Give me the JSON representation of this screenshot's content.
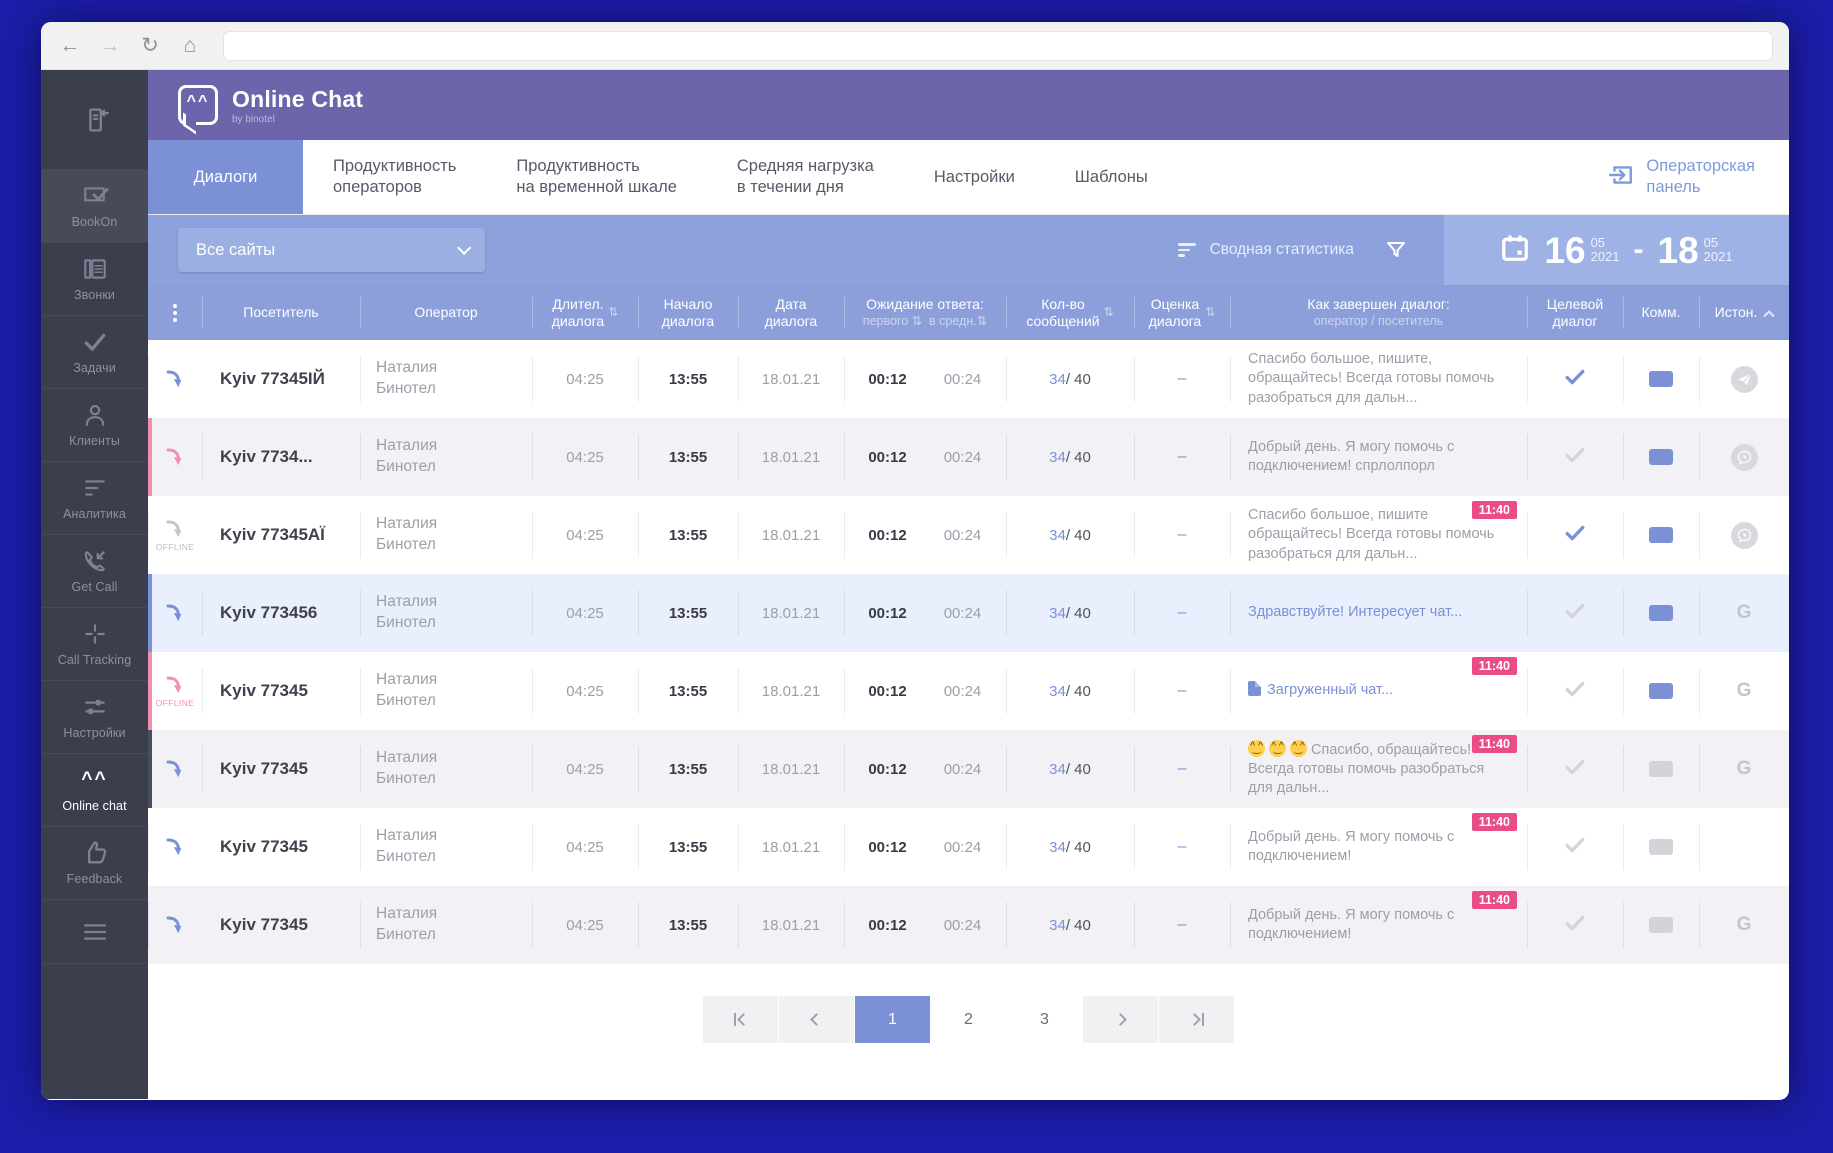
{
  "browser": {
    "url": ""
  },
  "brand": {
    "title": "Online Chat",
    "subtitle": "by binotel",
    "face": "^^"
  },
  "sidebar": {
    "items": [
      {
        "icon": "collapse-icon",
        "label": "",
        "active": false,
        "tall": true
      },
      {
        "icon": "bookon-icon",
        "label": "BookOn",
        "active": false,
        "hl": true
      },
      {
        "icon": "phone-icon",
        "label": "Звонки",
        "active": false
      },
      {
        "icon": "check-icon",
        "label": "Задачи",
        "active": false
      },
      {
        "icon": "person-icon",
        "label": "Клиенты",
        "active": false
      },
      {
        "icon": "analytics-icon",
        "label": "Аналитика",
        "active": false
      },
      {
        "icon": "getcall-icon",
        "label": "Get Call",
        "active": false
      },
      {
        "icon": "calltracking-icon",
        "label": "Call Tracking",
        "active": false
      },
      {
        "icon": "sliders-icon",
        "label": "Настройки",
        "active": false
      },
      {
        "icon": "chat-eyes-icon",
        "label": "Online chat",
        "active": true
      },
      {
        "icon": "thumbsup-icon",
        "label": "Feedback",
        "active": false
      },
      {
        "icon": "hamburger-icon",
        "label": "",
        "active": false,
        "short": true
      }
    ]
  },
  "tabs": [
    {
      "label": "Диалоги",
      "active": true
    },
    {
      "label": "Продуктивность\nоператоров",
      "active": false
    },
    {
      "label": "Продуктивность\nна временной шкале",
      "active": false
    },
    {
      "label": "Средняя нагрузка\nв течении дня",
      "active": false
    },
    {
      "label": "Настройки",
      "active": false
    },
    {
      "label": "Шаблоны",
      "active": false
    }
  ],
  "operator_panel": {
    "label": "Операторская\nпанель"
  },
  "filterbar": {
    "sites_dropdown": "Все сайты",
    "summary_label": "Сводная статистика",
    "date_from": {
      "day": "16",
      "month": "05",
      "year": "2021"
    },
    "date_separator": "-",
    "date_to": {
      "day": "18",
      "month": "05",
      "year": "2021"
    }
  },
  "table": {
    "headers": {
      "visitor": "Посетитель",
      "operator": "Оператор",
      "duration": "Длител.\nдиалога",
      "start": "Начало\nдиалога",
      "date": "Дата\nдиалога",
      "wait": "Ожидание ответа:",
      "wait_sub_first": "первого",
      "wait_sub_avg": "в средн.",
      "messages": "Кол-во\nсообщений",
      "rating": "Оценка\nдиалога",
      "ended": "Как завершен диалог:",
      "ended_sub": "оператор / посетитель",
      "target": "Целевой\nдиалог",
      "comment": "Комм.",
      "source": "Истон.",
      "sort_glyph": "⇅"
    },
    "rows": [
      {
        "arrow": "blue",
        "offline": "",
        "visitor": "Kyiv 77345ІЙ",
        "operator": "Наталия Бинотел",
        "duration": "04:25",
        "start": "13:55",
        "date": "18.01.21",
        "wait_first": "00:12",
        "wait_avg": "00:24",
        "msg_current": "34",
        "msg_total": " / 40",
        "rating": "–",
        "badge": "",
        "message": "Спасибо большое, пишите, обращайтесь! Всегда готовы помочь разобраться для дальн...",
        "msg_style": "gray",
        "file": false,
        "emojis": 0,
        "target": "blue",
        "comment": "blue",
        "source": "telegram",
        "accent": "",
        "bg": ""
      },
      {
        "arrow": "pink",
        "offline": "",
        "visitor": "Kyiv 7734...",
        "operator": "Наталия Бинотел",
        "duration": "04:25",
        "start": "13:55",
        "date": "18.01.21",
        "wait_first": "00:12",
        "wait_avg": "00:24",
        "msg_current": "34",
        "msg_total": " / 40",
        "rating": "–",
        "badge": "",
        "message": "Добрый день. Я могу помочь с подключением! спрлолпорл",
        "msg_style": "gray",
        "file": false,
        "emojis": 0,
        "target": "gray",
        "comment": "blue",
        "source": "viber",
        "accent": "pink",
        "bg": "alt"
      },
      {
        "arrow": "gray",
        "offline": "OFFLINE",
        "visitor": "Kyiv 77345АЇ",
        "operator": "Наталия Бинотел",
        "duration": "04:25",
        "start": "13:55",
        "date": "18.01.21",
        "wait_first": "00:12",
        "wait_avg": "00:24",
        "msg_current": "34",
        "msg_total": " / 40",
        "rating": "–",
        "badge": "11:40",
        "message": "Спасибо большое, пишите обращайтесь! Всегда готовы помочь разобраться для дальн...",
        "msg_style": "gray",
        "file": false,
        "emojis": 0,
        "target": "blue",
        "comment": "blue",
        "source": "viber",
        "accent": "",
        "bg": ""
      },
      {
        "arrow": "blue",
        "offline": "",
        "visitor": "Kyiv 773456",
        "operator": "Наталия Бинотел",
        "duration": "04:25",
        "start": "13:55",
        "date": "18.01.21",
        "wait_first": "00:12",
        "wait_avg": "00:24",
        "msg_current": "34",
        "msg_total": " / 40",
        "rating": "–",
        "badge": "",
        "message": "Здравствуйте! Интересует чат...",
        "msg_style": "link",
        "file": false,
        "emojis": 0,
        "target": "gray",
        "comment": "blue",
        "source": "google",
        "accent": "blue",
        "bg": "selected"
      },
      {
        "arrow": "pink",
        "offline": "OFFLINE",
        "visitor": "Kyiv 77345",
        "operator": "Наталия Бинотел",
        "duration": "04:25",
        "start": "13:55",
        "date": "18.01.21",
        "wait_first": "00:12",
        "wait_avg": "00:24",
        "msg_current": "34",
        "msg_total": " / 40",
        "rating": "–",
        "badge": "11:40",
        "message": "Загруженный чат...",
        "msg_style": "link",
        "file": true,
        "emojis": 0,
        "target": "gray",
        "comment": "blue",
        "source": "google",
        "accent": "pink",
        "bg": ""
      },
      {
        "arrow": "blue",
        "offline": "",
        "visitor": "Kyiv 77345",
        "operator": "Наталия Бинотел",
        "duration": "04:25",
        "start": "13:55",
        "date": "18.01.21",
        "wait_first": "00:12",
        "wait_avg": "00:24",
        "msg_current": "34",
        "msg_total": " / 40",
        "rating": "–",
        "badge": "11:40",
        "message": "Спасибо, обращайтесь! Всегда готовы помочь разобраться для дальн...",
        "msg_style": "gray",
        "file": false,
        "emojis": 3,
        "target": "gray",
        "comment": "gray",
        "source": "google",
        "accent": "navy",
        "bg": "alt"
      },
      {
        "arrow": "blue",
        "offline": "",
        "visitor": "Kyiv 77345",
        "operator": "Наталия Бинотел",
        "duration": "04:25",
        "start": "13:55",
        "date": "18.01.21",
        "wait_first": "00:12",
        "wait_avg": "00:24",
        "msg_current": "34",
        "msg_total": " / 40",
        "rating": "–",
        "badge": "11:40",
        "message": "Добрый день. Я могу помочь с подключением!",
        "msg_style": "gray",
        "file": false,
        "emojis": 0,
        "target": "gray",
        "comment": "gray",
        "source": "none",
        "accent": "",
        "bg": ""
      },
      {
        "arrow": "blue",
        "offline": "",
        "visitor": "Kyiv 77345",
        "operator": "Наталия Бинотел",
        "duration": "04:25",
        "start": "13:55",
        "date": "18.01.21",
        "wait_first": "00:12",
        "wait_avg": "00:24",
        "msg_current": "34",
        "msg_total": " / 40",
        "rating": "–",
        "badge": "11:40",
        "message": "Добрый день. Я могу помочь с подключением!",
        "msg_style": "gray",
        "file": false,
        "emojis": 0,
        "target": "gray",
        "comment": "gray",
        "source": "google",
        "accent": "",
        "bg": "alt"
      }
    ]
  },
  "pagination": {
    "pages": [
      "1",
      "2",
      "3"
    ],
    "active": "1"
  }
}
